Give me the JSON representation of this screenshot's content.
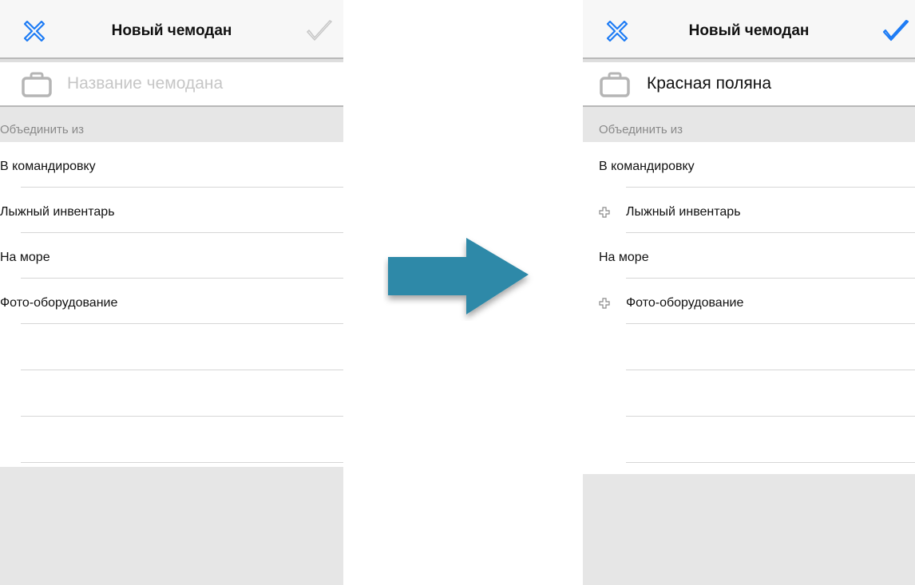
{
  "left_screen": {
    "title": "Новый чемодан",
    "close_icon": "close-x-icon",
    "done_icon": "checkmark-icon",
    "done_enabled": false,
    "name_value": "",
    "name_placeholder": "Название чемодана",
    "section_header": "Объединить из",
    "items": [
      {
        "label": "В командировку",
        "selected": false
      },
      {
        "label": "Лыжный инвентарь",
        "selected": false
      },
      {
        "label": "На море",
        "selected": false
      },
      {
        "label": "Фото-оборудование",
        "selected": false
      }
    ]
  },
  "right_screen": {
    "title": "Новый чемодан",
    "close_icon": "close-x-icon",
    "done_icon": "checkmark-icon",
    "done_enabled": true,
    "name_value": "Красная поляна",
    "name_placeholder": "Название чемодана",
    "section_header": "Объединить из",
    "items": [
      {
        "label": "В командировку",
        "selected": false
      },
      {
        "label": "Лыжный инвентарь",
        "selected": true
      },
      {
        "label": "На море",
        "selected": false
      },
      {
        "label": "Фото-оборудование",
        "selected": true
      }
    ]
  },
  "colors": {
    "accent": "#1e7cf5",
    "disabled": "#c8c8c8",
    "arrow": "#2d89a8"
  },
  "arrow_icon": "right-arrow-icon"
}
